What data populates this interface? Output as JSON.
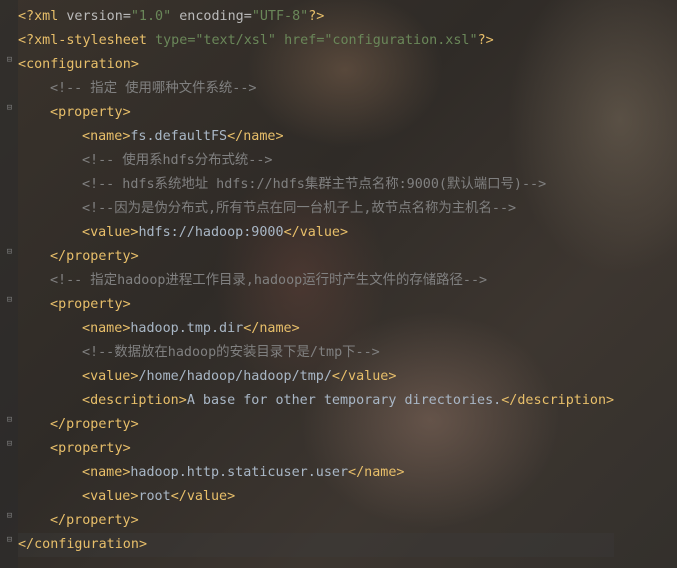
{
  "line1": {
    "start": "<?",
    "name": "xml",
    "a1": "version",
    "v1": "\"1.0\"",
    "a2": "encoding",
    "v2": "\"UTF-8\"",
    "end": "?>"
  },
  "line2": {
    "start": "<?",
    "name": "xml-stylesheet",
    "a1": "type",
    "v1": "\"text/xsl\"",
    "a2": "href",
    "v2": "\"configuration.xsl\"",
    "end": "?>"
  },
  "tags": {
    "configuration": "configuration",
    "property": "property",
    "name": "name",
    "value": "value",
    "description": "description"
  },
  "comments": {
    "c1": "<!-- 指定 使用哪种文件系统-->",
    "c2": "<!-- 使用系hdfs分布式统-->",
    "c3": "<!-- hdfs系统地址 hdfs://hdfs集群主节点名称:9000(默认端口号)-->",
    "c4": "<!--因为是伪分布式,所有节点在同一台机子上,故节点名称为主机名-->",
    "c5": "<!-- 指定hadoop进程工作目录,hadoop运行时产生文件的存储路径-->",
    "c6": "<!--数据放在hadoop的安装目录下是/tmp下-->"
  },
  "values": {
    "p1_name": "fs.defaultFS",
    "p1_value": "hdfs://hadoop:9000",
    "p2_name": "hadoop.tmp.dir",
    "p2_value": "/home/hadoop/hadoop/tmp/",
    "p2_description": "A base for other temporary directories.",
    "p3_name": "hadoop.http.staticuser.user",
    "p3_value": "root"
  },
  "colors": {
    "tag": "#e8bf6a",
    "string": "#6a8759",
    "text": "#a9b7c6",
    "comment": "#808080"
  },
  "icons": {
    "fold": "fold-marker-icon"
  }
}
